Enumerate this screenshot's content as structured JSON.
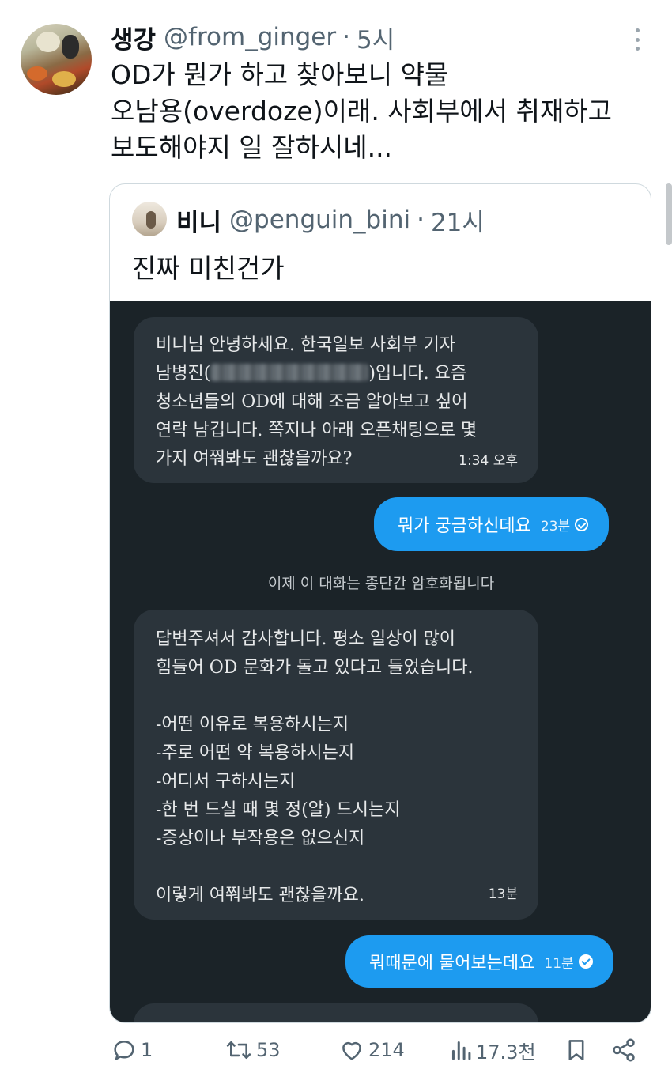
{
  "tweet": {
    "display_name": "생강",
    "handle": "@from_ginger",
    "separator": "·",
    "time": "5시",
    "text_lines": [
      "OD가 뭔가 하고 찾아보니 약물",
      "오남용(overdoze)이래. 사회부에서 취재하고",
      "보도해야지 일 잘하시네..."
    ]
  },
  "quote": {
    "display_name": "비니",
    "handle": "@penguin_bini",
    "separator": "·",
    "time": "21시",
    "text": "진짜 미친건가"
  },
  "chat": {
    "message1": {
      "lines": [
        "비니님 안녕하세요. 한국일보 사회부 기자",
        "남병진(",
        ")입니다. 요즘",
        "청소년들의 OD에 대해 조금 알아보고 싶어",
        "연락 남깁니다. 쪽지나 아래 오픈채팅으로 몇",
        "가지 여쭤봐도 괜찮을까요?"
      ],
      "time": "1:34 오후"
    },
    "reply1": {
      "text": "뭐가 궁금하신데요",
      "time": "23분"
    },
    "system_note": "이제 이 대화는 종단간 암호화됩니다",
    "message2": {
      "lines": [
        "답변주셔서 감사합니다. 평소 일상이 많이",
        "힘들어 OD 문화가 돌고 있다고 들었습니다.",
        "",
        "-어떤 이유로 복용하시는지",
        "-주로 어떤 약 복용하시는지",
        "-어디서 구하시는지",
        "-한 번 드실 때 몇 정(알) 드시는지",
        "-증상이나 부작용은 없으신지",
        "",
        "이렇게 여쭤봐도 괜찮을까요."
      ],
      "time": "13분"
    },
    "reply2": {
      "text": "뭐때문에 물어보는데요",
      "time": "11분"
    }
  },
  "actions": {
    "reply_count": "1",
    "retweet_count": "53",
    "like_count": "214",
    "views_count": "17.3천"
  },
  "colors": {
    "accent": "#1d9bf0",
    "chat_bg": "#1b2328",
    "bubble_in": "#2b343b",
    "muted_text": "#536471"
  },
  "icons": [
    "more-icon",
    "reply-icon",
    "retweet-icon",
    "like-icon",
    "views-icon",
    "bookmark-icon",
    "share-icon",
    "read-check-icon"
  ]
}
